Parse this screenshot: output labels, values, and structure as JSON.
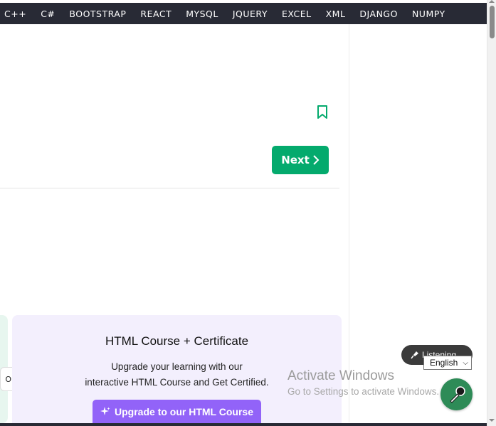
{
  "topnav": {
    "items": [
      "C++",
      "C#",
      "BOOTSTRAP",
      "REACT",
      "MYSQL",
      "JQUERY",
      "EXCEL",
      "XML",
      "DJANGO",
      "NUMPY"
    ]
  },
  "nav_buttons": {
    "next_label": "Next"
  },
  "course": {
    "title": "HTML Course + Certificate",
    "desc_line1": "Upgrade your learning with our",
    "desc_line2": "interactive HTML Course and Get Certified.",
    "upgrade_label": "Upgrade to our HTML Course"
  },
  "or_label": "OR",
  "overlay": {
    "listening_label": "Listening...",
    "language": "English"
  },
  "watermark": {
    "title": "Activate Windows",
    "subtitle": "Go to Settings to activate Windows."
  },
  "colors": {
    "nav_bg": "#282a35",
    "accent_green": "#04aa6d",
    "upgrade_purple": "#9263f8",
    "card_bg": "#f3effd"
  },
  "icons": [
    "bookmark-icon",
    "chevron-right-icon",
    "sparkle-icon",
    "microphone-icon"
  ]
}
